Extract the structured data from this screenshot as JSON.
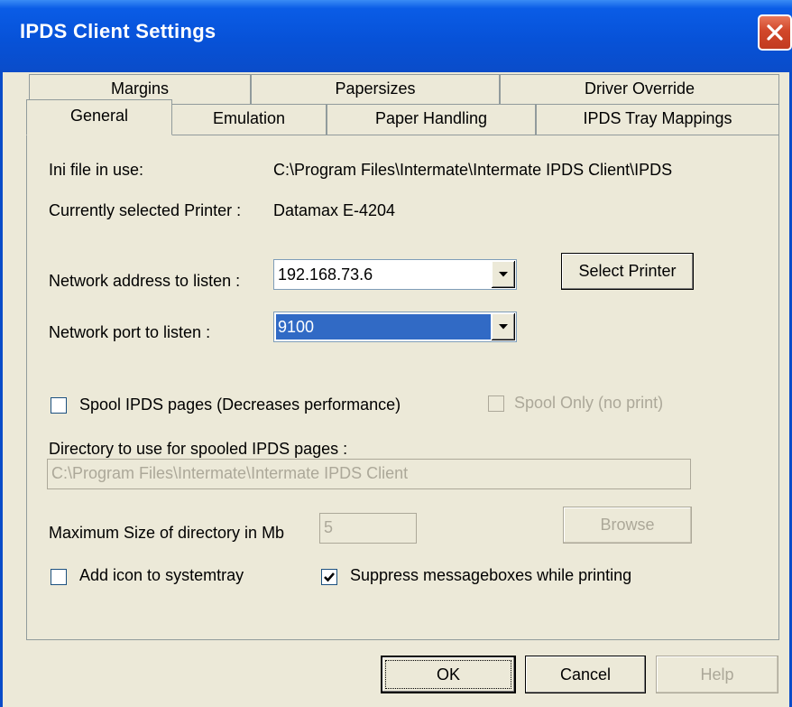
{
  "window": {
    "title": "IPDS Client Settings"
  },
  "tabs": {
    "back": [
      "Margins",
      "Papersizes",
      "Driver Override"
    ],
    "front": [
      "General",
      "Emulation",
      "Paper Handling",
      "IPDS Tray Mappings"
    ],
    "active": "General"
  },
  "general": {
    "ini_label": "Ini file in use:",
    "ini_value": "C:\\Program Files\\Intermate\\Intermate IPDS Client\\IPDS",
    "printer_label": "Currently selected Printer :",
    "printer_value": "Datamax E-4204",
    "address_label": "Network address to listen :",
    "address_value": "192.168.73.6",
    "port_label": "Network port to listen :",
    "port_value": "9100",
    "select_printer": "Select Printer",
    "spool_label": "Spool IPDS pages (Decreases performance)",
    "spool_checked": false,
    "spool_only_label": "Spool Only (no print)",
    "spool_only_checked": false,
    "directory_label": "Directory to use for spooled IPDS pages :",
    "directory_value": "C:\\Program Files\\Intermate\\Intermate IPDS Client",
    "maxsize_label": "Maximum Size of directory in Mb",
    "maxsize_value": "5",
    "browse": "Browse",
    "systray_label": "Add icon to systemtray",
    "systray_checked": false,
    "suppress_label": "Suppress messageboxes while printing",
    "suppress_checked": true
  },
  "buttons": {
    "ok": "OK",
    "cancel": "Cancel",
    "help": "Help"
  }
}
